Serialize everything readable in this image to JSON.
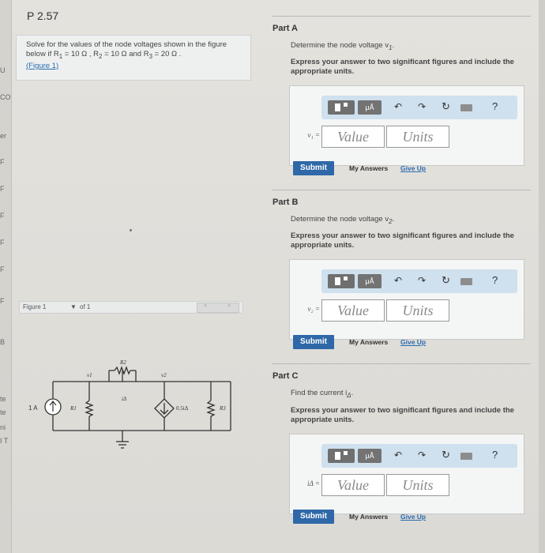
{
  "left_strip": [
    "U",
    "CO",
    "er",
    "F",
    "F",
    "F",
    "F",
    "F",
    "F",
    "B",
    "te",
    "te",
    "ni",
    "I T"
  ],
  "problem": {
    "title": "P 2.57",
    "text_prefix": "Solve for the values of the node voltages shown in the figure below if R",
    "r1": "1",
    "v1": " = 10 Ω , R",
    "r2": "2",
    "v2": " = 10 Ω and R",
    "r3": "3",
    "v3": " = 20 Ω .",
    "figure_link": "(Figure 1)"
  },
  "figure_bar": {
    "label": "Figure 1",
    "dropdown": "▼",
    "count": "of 1",
    "prev": "<",
    "next": ">"
  },
  "circuit_labels": {
    "source": "1 A",
    "r1": "R1",
    "r2": "R2",
    "r3": "R3",
    "node1": "v1",
    "node2": "v2",
    "i_delta": "iΔ",
    "dep_source": "0.5iΔ"
  },
  "parts": [
    {
      "title": "Part A",
      "description": "Determine the node voltage v",
      "desc_sub": "1",
      "instruction": "Express your answer to two significant figures and include the appropriate units.",
      "var_label": "v₁ =",
      "value_placeholder": "Value",
      "units_placeholder": "Units",
      "submit": "Submit",
      "my_answers": "My Answers",
      "give_up": "Give Up"
    },
    {
      "title": "Part B",
      "description": "Determine the node voltage v",
      "desc_sub": "2",
      "instruction": "Express your answer to two significant figures and include the appropriate units.",
      "var_label": "v₂ =",
      "value_placeholder": "Value",
      "units_placeholder": "Units",
      "submit": "Submit",
      "my_answers": "My Answers",
      "give_up": "Give Up"
    },
    {
      "title": "Part C",
      "description": "Find the current i",
      "desc_sub": "Δ",
      "instruction": "Express your answer to two significant figures and include the appropriate units.",
      "var_label": "iΔ =",
      "value_placeholder": "Value",
      "units_placeholder": "Units",
      "submit": "Submit",
      "my_answers": "My Answers",
      "give_up": "Give Up"
    }
  ],
  "toolbar": {
    "mu": "μÅ",
    "undo": "↶",
    "redo": "↷",
    "reset": "↻",
    "help": "?"
  },
  "colors": {
    "accent": "#2f68a8",
    "toolbar": "#cfe0ee",
    "link": "#2a6bb0"
  }
}
